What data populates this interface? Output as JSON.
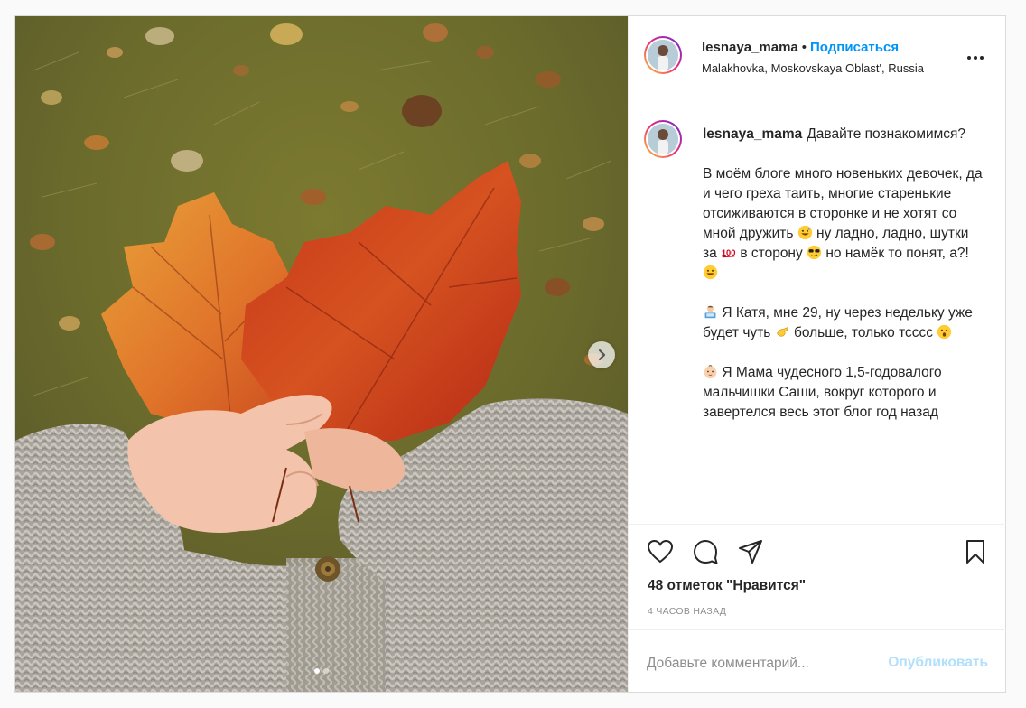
{
  "post": {
    "username": "lesnaya_mama",
    "separator": "•",
    "follow_label": "Подписаться",
    "location": "Malakhovka, Moskovskaya Oblast', Russia",
    "caption": {
      "p1": "Давайте познакомимся?",
      "p2_a": "В моём блоге много новеньких девочек, да и чего греха таить, многие старенькие отсиживаются в сторонке и не хотят со мной дружить",
      "p2_b": "ну ладно, ладно, шутки за",
      "p2_c": "в сторону",
      "p2_d": "но намёк то понят, а?!",
      "p3_a": "Я Катя, мне 29, ну через недельку уже будет чуть",
      "p3_b": "больше, только тсссс",
      "p4": "Я Мама чудесного 1,5-годовалого мальчишки Саши, вокруг которого и завертелся весь этот блог год назад"
    },
    "emojis": [
      "grinning-sweat-emoji",
      "hundred-points-emoji",
      "sunglasses-emoji",
      "grinning-emoji",
      "person-at-laptop-emoji",
      "pinching-hand-emoji",
      "hushed-emoji",
      "baby-emoji"
    ],
    "likes_text": "48 отметок \"Нравится\"",
    "time_text": "4 ЧАСОВ НАЗАД",
    "comment_placeholder": "Добавьте комментарий...",
    "publish_label": "Опубликовать",
    "carousel": {
      "count": 2,
      "active_index": 0
    }
  },
  "colors": {
    "accent": "#0095f6",
    "publish_disabled": "#b2dffc",
    "muted": "#8e8e8e"
  }
}
